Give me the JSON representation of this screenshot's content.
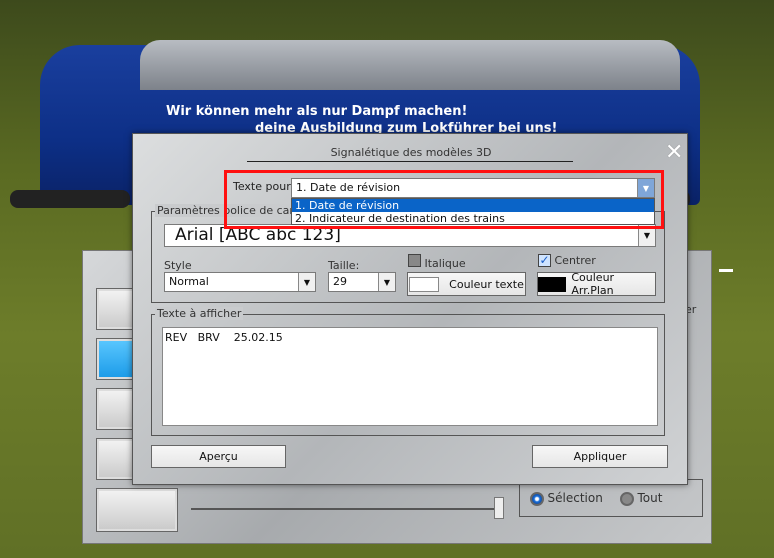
{
  "background": {
    "slogan_line1": "Wir können mehr als nur Dampf machen!",
    "slogan_line2": "deine Ausbildung zum Lokführer bei uns!",
    "loco_color": "#1a3f9e"
  },
  "back_panel": {
    "partial_label": "er",
    "radio_selection": "Sélection",
    "radio_all": "Tout",
    "selected_radio": "Sélection",
    "slider_value_fraction": 1.0
  },
  "dialog": {
    "title": "Signalétique des modèles 3D",
    "close_icon": "close-icon",
    "texte_pour_label": "Texte pour",
    "texte_pour_value": "1. Date de révision",
    "texte_pour_options": [
      "1. Date de révision",
      "2. Indicateur de destination des trains"
    ],
    "font_group_label": "Paramètres police de caractères",
    "font_value": "Arial  [ABC abc 123]",
    "style_label": "Style",
    "style_value": "Normal",
    "size_label": "Taille:",
    "size_value": "29",
    "italic_label": "Italique",
    "italic_checked": false,
    "center_label": "Centrer",
    "center_checked": true,
    "text_color_button": "Couleur texte",
    "text_color": "#ffffff",
    "bg_color_button": "Couleur Arr.Plan",
    "bg_color": "#000000",
    "text_group_label": "Texte à afficher",
    "text_value": "REV   BRV    25.02.15",
    "preview_button": "Aperçu",
    "apply_button": "Appliquer"
  },
  "highlight_color": "#ff1010",
  "selection_color": "#0a64c8"
}
